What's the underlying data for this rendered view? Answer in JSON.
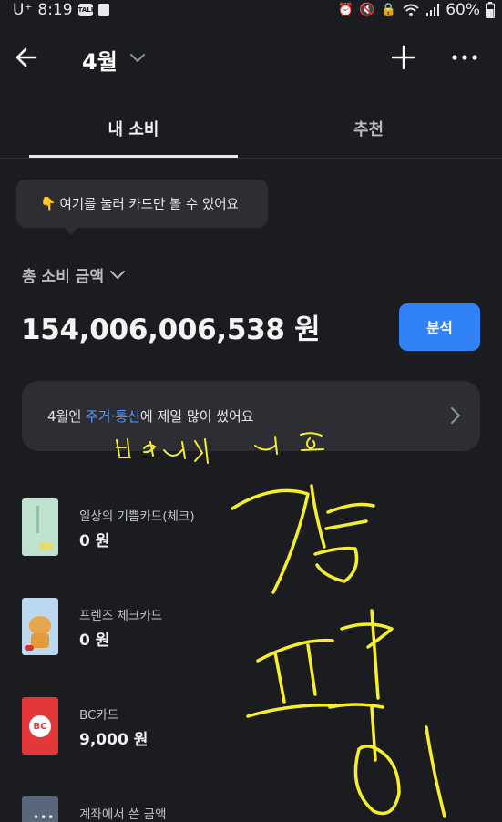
{
  "status_bar": {
    "carrier": "U⁺",
    "time": "8:19",
    "notification_icons": [
      "talk-icon",
      "gallery-icon"
    ],
    "system_icons": [
      "alarm-icon",
      "mute-icon",
      "lock-icon",
      "wifi-icon",
      "signal-icon"
    ],
    "battery": "60%"
  },
  "header": {
    "month": "4월"
  },
  "tabs": [
    {
      "label": "내 소비",
      "active": true
    },
    {
      "label": "추천",
      "active": false
    }
  ],
  "tooltip": {
    "emoji": "👇",
    "text": "여기를 눌러 카드만 볼 수 있어요"
  },
  "summary": {
    "label": "총 소비 금액",
    "amount": "154,006,006,538 원",
    "analyze_button": "분석"
  },
  "insight": {
    "prefix": "4월엔 ",
    "highlight": "주거·통신",
    "suffix": "에 제일 많이 썼어요"
  },
  "cards": [
    {
      "name": "일상의 기쁨카드(체크)",
      "amount": "0 원",
      "thumb": "mint-card"
    },
    {
      "name": "프렌즈 체크카드",
      "amount": "0 원",
      "thumb": "friends-card"
    },
    {
      "name": "BC카드",
      "amount": "9,000 원",
      "thumb": "bc-card",
      "logo_text": "BC"
    },
    {
      "name": "계좌에서 쓴 금액",
      "amount": "",
      "thumb": "account"
    }
  ],
  "colors": {
    "background": "#1b1c20",
    "accent": "#3182f6",
    "highlight_text": "#4f9bff",
    "card_bg": "#2c2e33",
    "handwriting": "#f6ef2a"
  }
}
